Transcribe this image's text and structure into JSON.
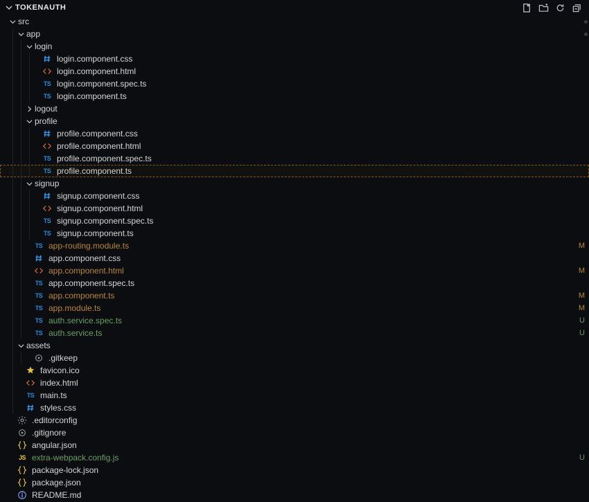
{
  "title": "TOKENAUTH",
  "status_labels": {
    "modified": "M",
    "untracked": "U"
  },
  "tree": [
    {
      "d": 0,
      "kind": "folder",
      "expand": "down",
      "name": "src",
      "dotIndex": 0
    },
    {
      "d": 1,
      "kind": "folder",
      "expand": "down",
      "name": "app",
      "dotIndex": 1
    },
    {
      "d": 2,
      "kind": "folder",
      "expand": "down",
      "name": "login"
    },
    {
      "d": 3,
      "kind": "file",
      "icon": "hash",
      "iconClass": "icon-css",
      "name": "login.component.css"
    },
    {
      "d": 3,
      "kind": "file",
      "icon": "angle",
      "iconClass": "icon-html",
      "name": "login.component.html"
    },
    {
      "d": 3,
      "kind": "file",
      "icon": "ts",
      "iconClass": "icon-ts",
      "name": "login.component.spec.ts"
    },
    {
      "d": 3,
      "kind": "file",
      "icon": "ts",
      "iconClass": "icon-ts",
      "name": "login.component.ts"
    },
    {
      "d": 2,
      "kind": "folder",
      "expand": "right",
      "name": "logout"
    },
    {
      "d": 2,
      "kind": "folder",
      "expand": "down",
      "name": "profile"
    },
    {
      "d": 3,
      "kind": "file",
      "icon": "hash",
      "iconClass": "icon-css",
      "name": "profile.component.css"
    },
    {
      "d": 3,
      "kind": "file",
      "icon": "angle",
      "iconClass": "icon-html",
      "name": "profile.component.html"
    },
    {
      "d": 3,
      "kind": "file",
      "icon": "ts",
      "iconClass": "icon-ts",
      "name": "profile.component.spec.ts"
    },
    {
      "d": 3,
      "kind": "file",
      "icon": "ts",
      "iconClass": "icon-ts",
      "name": "profile.component.ts",
      "selected": true
    },
    {
      "d": 2,
      "kind": "folder",
      "expand": "down",
      "name": "signup"
    },
    {
      "d": 3,
      "kind": "file",
      "icon": "hash",
      "iconClass": "icon-css",
      "name": "signup.component.css"
    },
    {
      "d": 3,
      "kind": "file",
      "icon": "angle",
      "iconClass": "icon-html",
      "name": "signup.component.html"
    },
    {
      "d": 3,
      "kind": "file",
      "icon": "ts",
      "iconClass": "icon-ts",
      "name": "signup.component.spec.ts"
    },
    {
      "d": 3,
      "kind": "file",
      "icon": "ts",
      "iconClass": "icon-ts",
      "name": "signup.component.ts"
    },
    {
      "d": 2,
      "kind": "file",
      "icon": "ts",
      "iconClass": "icon-ts",
      "name": "app-routing.module.ts",
      "status": "modified"
    },
    {
      "d": 2,
      "kind": "file",
      "icon": "hash",
      "iconClass": "icon-css",
      "name": "app.component.css"
    },
    {
      "d": 2,
      "kind": "file",
      "icon": "angle",
      "iconClass": "icon-html",
      "name": "app.component.html",
      "status": "modified"
    },
    {
      "d": 2,
      "kind": "file",
      "icon": "ts",
      "iconClass": "icon-ts",
      "name": "app.component.spec.ts"
    },
    {
      "d": 2,
      "kind": "file",
      "icon": "ts",
      "iconClass": "icon-ts",
      "name": "app.component.ts",
      "status": "modified"
    },
    {
      "d": 2,
      "kind": "file",
      "icon": "ts",
      "iconClass": "icon-ts",
      "name": "app.module.ts",
      "status": "modified"
    },
    {
      "d": 2,
      "kind": "file",
      "icon": "ts",
      "iconClass": "icon-ts",
      "name": "auth.service.spec.ts",
      "status": "untracked"
    },
    {
      "d": 2,
      "kind": "file",
      "icon": "ts",
      "iconClass": "icon-ts",
      "name": "auth.service.ts",
      "status": "untracked"
    },
    {
      "d": 1,
      "kind": "folder",
      "expand": "down",
      "name": "assets"
    },
    {
      "d": 2,
      "kind": "file",
      "icon": "dot",
      "iconClass": "icon-dot",
      "name": ".gitkeep"
    },
    {
      "d": 1,
      "kind": "file",
      "icon": "star",
      "iconClass": "icon-fav",
      "name": "favicon.ico"
    },
    {
      "d": 1,
      "kind": "file",
      "icon": "angle",
      "iconClass": "icon-html",
      "name": "index.html"
    },
    {
      "d": 1,
      "kind": "file",
      "icon": "ts",
      "iconClass": "icon-ts",
      "name": "main.ts"
    },
    {
      "d": 1,
      "kind": "file",
      "icon": "hash",
      "iconClass": "icon-css",
      "name": "styles.css"
    },
    {
      "d": 0,
      "kind": "file",
      "icon": "gear",
      "iconClass": "icon-gear",
      "name": ".editorconfig"
    },
    {
      "d": 0,
      "kind": "file",
      "icon": "dot",
      "iconClass": "icon-dot",
      "name": ".gitignore"
    },
    {
      "d": 0,
      "kind": "file",
      "icon": "braces",
      "iconClass": "icon-json",
      "name": "angular.json"
    },
    {
      "d": 0,
      "kind": "file",
      "icon": "js",
      "iconClass": "icon-js",
      "name": "extra-webpack.config.js",
      "status": "untracked"
    },
    {
      "d": 0,
      "kind": "file",
      "icon": "braces",
      "iconClass": "icon-json",
      "name": "package-lock.json"
    },
    {
      "d": 0,
      "kind": "file",
      "icon": "braces",
      "iconClass": "icon-json",
      "name": "package.json"
    },
    {
      "d": 0,
      "kind": "file",
      "icon": "info",
      "iconClass": "icon-md",
      "name": "README.md"
    }
  ]
}
